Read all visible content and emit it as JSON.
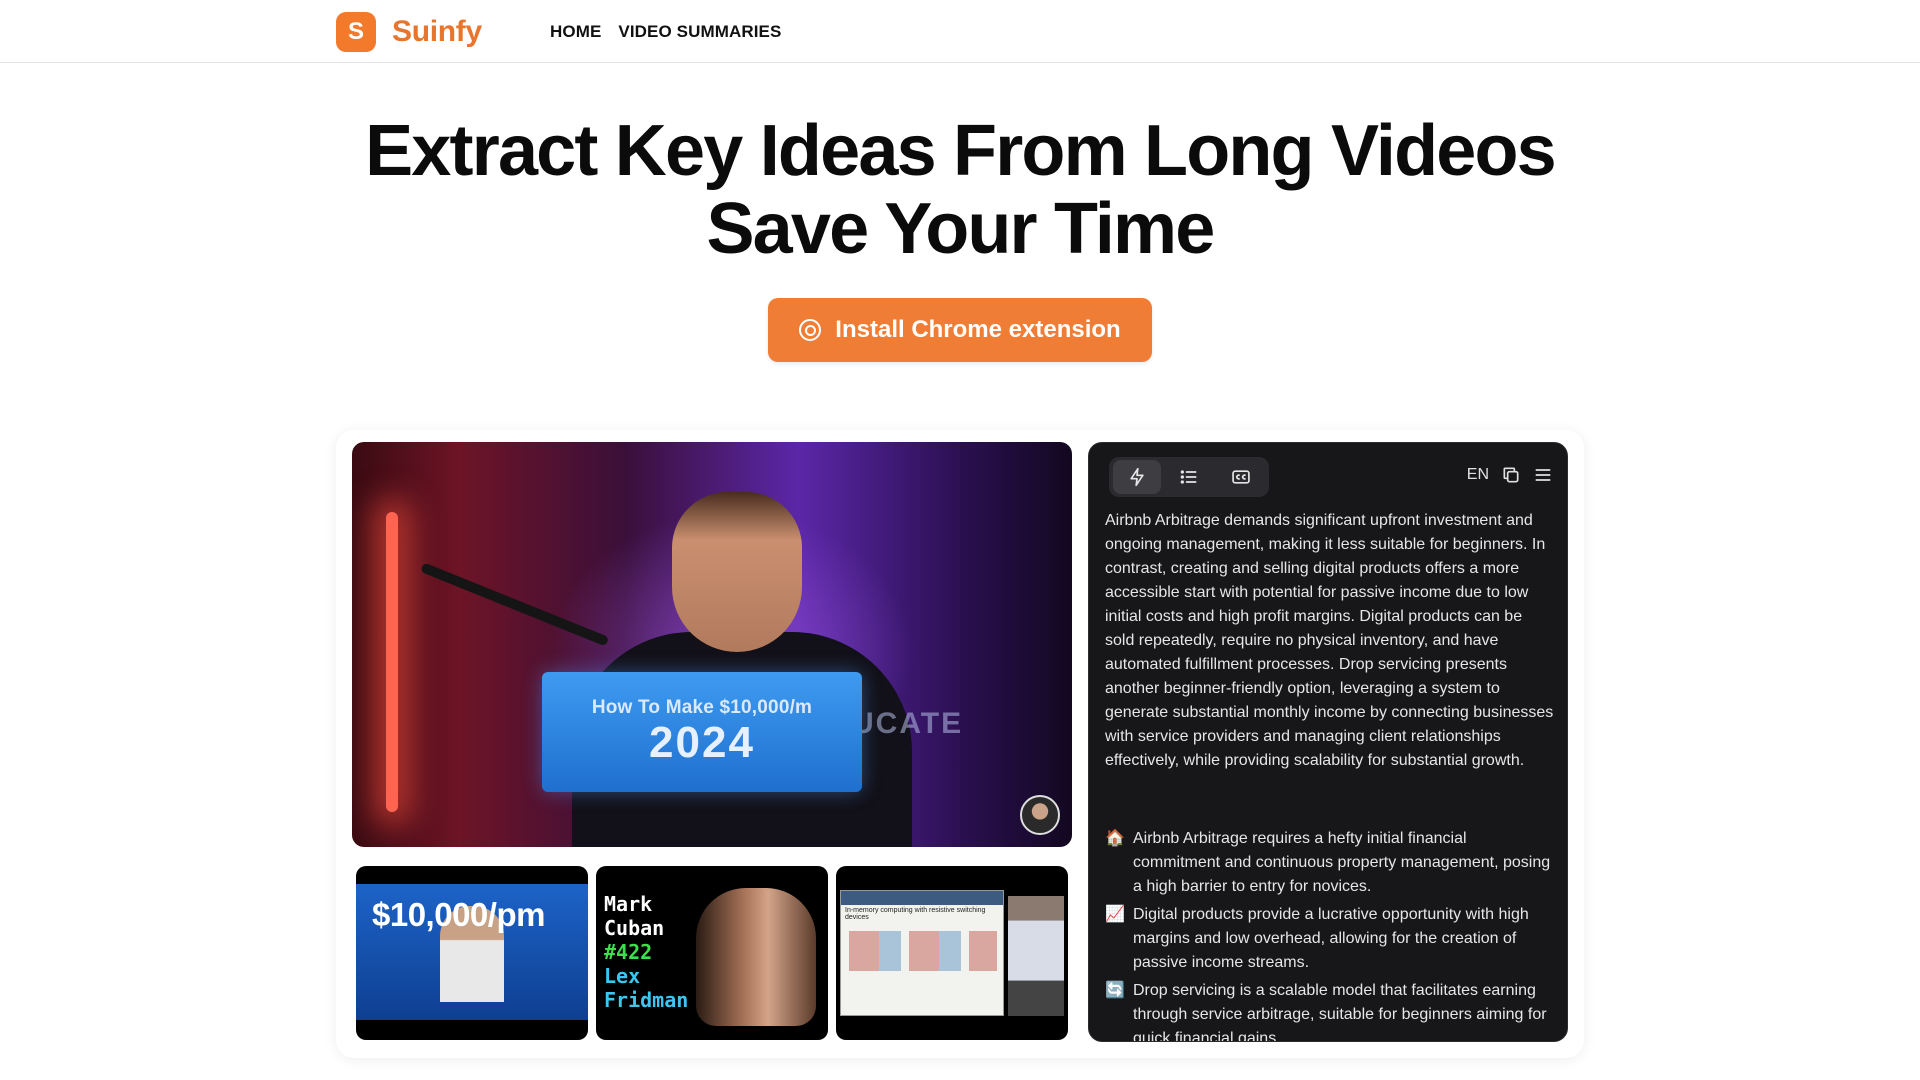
{
  "brand": {
    "logo_letter": "S",
    "name": "Suinfy"
  },
  "nav": {
    "items": [
      "HOME",
      "VIDEO SUMMARIES"
    ]
  },
  "hero": {
    "title_line1": "Extract Key Ideas From Long Videos",
    "title_line2": "Save Your Time",
    "cta_label": "Install Chrome extension"
  },
  "main_video": {
    "overlay_line1": "How To Make $10,000/m",
    "overlay_line2": "2024",
    "background_text": "UCATE"
  },
  "thumbnails": [
    {
      "title": "$10,000/pm"
    },
    {
      "lines": [
        "Mark",
        "Cuban",
        "#422",
        "Lex",
        "Fridman"
      ]
    },
    {
      "slide_title": "In-memory computing with resistive switching devices"
    }
  ],
  "panel": {
    "tabs": [
      "lightning-icon",
      "list-icon",
      "cc-icon"
    ],
    "language": "EN",
    "summary": "Airbnb Arbitrage demands significant upfront investment and ongoing management, making it less suitable for beginners. In contrast, creating and selling digital products offers a more accessible start with potential for passive income due to low initial costs and high profit margins. Digital products can be sold repeatedly, require no physical inventory, and have automated fulfillment processes. Drop servicing presents another beginner-friendly option, leveraging a system to generate substantial monthly income by connecting businesses with service providers and managing client relationships effectively, while providing scalability for substantial growth.",
    "points": [
      {
        "emoji": "🏠",
        "text": "Airbnb Arbitrage requires a hefty initial financial commitment and continuous property management, posing a high barrier to entry for novices."
      },
      {
        "emoji": "📈",
        "text": "Digital products provide a lucrative opportunity with high margins and low overhead, allowing for the creation of passive income streams."
      },
      {
        "emoji": "🔄",
        "text": "Drop servicing is a scalable model that facilitates earning through service arbitrage, suitable for beginners aiming for quick financial gains."
      }
    ]
  },
  "colors": {
    "accent": "#f07d35",
    "panel_bg": "#17171a"
  }
}
